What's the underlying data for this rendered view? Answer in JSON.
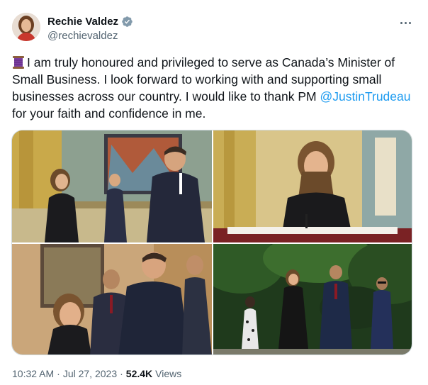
{
  "author": {
    "name": "Rechie Valdez",
    "handle": "@rechievaldez",
    "verified": true
  },
  "tweet": {
    "text_before_mention": "I am truly honoured and privileged to serve as Canada’s Minister of Small Business. I look forward to working with and supporting small businesses across our country. I would like to thank PM ",
    "mention": "@JustinTrudeau",
    "text_after_mention": " for your faith and confidence in me.",
    "leading_emoji": "spool-of-thread"
  },
  "media": {
    "photos": [
      {
        "name": "swearing-in-room-photo"
      },
      {
        "name": "signing-document-photo"
      },
      {
        "name": "handshake-photo"
      },
      {
        "name": "family-walking-photo"
      }
    ]
  },
  "meta": {
    "time": "10:32 AM",
    "separator": "·",
    "date": "Jul 27, 2023",
    "views_count": "52.4K",
    "views_label": "Views"
  },
  "colors": {
    "accent": "#1d9bf0",
    "secondary_text": "#536471",
    "primary_text": "#0f1419"
  }
}
